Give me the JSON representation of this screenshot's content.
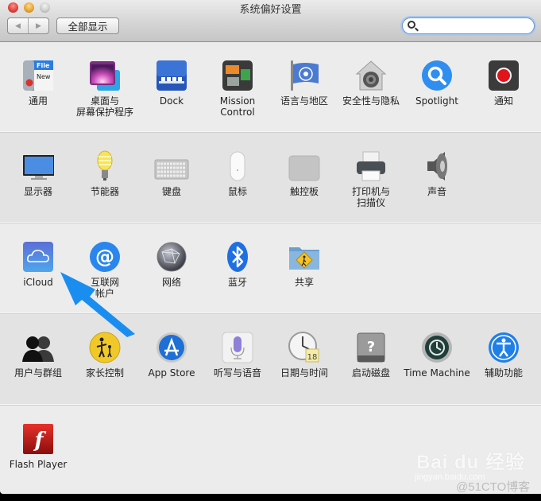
{
  "window": {
    "title": "系统偏好设置",
    "show_all_label": "全部显示",
    "back_icon": "◀",
    "forward_icon": "▶",
    "search": {
      "value": "",
      "placeholder": ""
    }
  },
  "sections": [
    {
      "items": [
        {
          "id": "general",
          "label": "通用",
          "icon": "general-icon"
        },
        {
          "id": "desktop",
          "label": "桌面与\n屏幕保护程序",
          "icon": "desktop-screensaver-icon"
        },
        {
          "id": "dock",
          "label": "Dock",
          "icon": "dock-icon"
        },
        {
          "id": "mission-control",
          "label": "Mission\nControl",
          "icon": "mission-control-icon"
        },
        {
          "id": "language",
          "label": "语言与地区",
          "icon": "language-flag-icon"
        },
        {
          "id": "security",
          "label": "安全性与隐私",
          "icon": "security-lock-icon"
        },
        {
          "id": "spotlight",
          "label": "Spotlight",
          "icon": "spotlight-icon"
        },
        {
          "id": "notifications",
          "label": "通知",
          "icon": "notifications-icon"
        }
      ]
    },
    {
      "items": [
        {
          "id": "displays",
          "label": "显示器",
          "icon": "display-icon"
        },
        {
          "id": "energy",
          "label": "节能器",
          "icon": "lightbulb-icon"
        },
        {
          "id": "keyboard",
          "label": "键盘",
          "icon": "keyboard-icon"
        },
        {
          "id": "mouse",
          "label": "鼠标",
          "icon": "mouse-icon"
        },
        {
          "id": "trackpad",
          "label": "触控板",
          "icon": "trackpad-icon"
        },
        {
          "id": "printers",
          "label": "打印机与\n扫描仪",
          "icon": "printer-icon"
        },
        {
          "id": "sound",
          "label": "声音",
          "icon": "speaker-icon"
        }
      ]
    },
    {
      "items": [
        {
          "id": "icloud",
          "label": "iCloud",
          "icon": "icloud-icon"
        },
        {
          "id": "internet-accounts",
          "label": "互联网\n帐户",
          "icon": "at-sign-icon"
        },
        {
          "id": "network",
          "label": "网络",
          "icon": "network-globe-icon"
        },
        {
          "id": "bluetooth",
          "label": "蓝牙",
          "icon": "bluetooth-icon"
        },
        {
          "id": "sharing",
          "label": "共享",
          "icon": "sharing-folder-icon"
        }
      ]
    },
    {
      "items": [
        {
          "id": "users",
          "label": "用户与群组",
          "icon": "users-icon"
        },
        {
          "id": "parental",
          "label": "家长控制",
          "icon": "parental-controls-icon"
        },
        {
          "id": "appstore",
          "label": "App Store",
          "icon": "app-store-icon"
        },
        {
          "id": "dictation",
          "label": "听写与语音",
          "icon": "microphone-icon"
        },
        {
          "id": "datetime",
          "label": "日期与时间",
          "icon": "clock-calendar-icon",
          "badge": "18"
        },
        {
          "id": "startup",
          "label": "启动磁盘",
          "icon": "startup-disk-icon"
        },
        {
          "id": "timemachine",
          "label": "Time Machine",
          "icon": "time-machine-icon"
        },
        {
          "id": "accessibility",
          "label": "辅助功能",
          "icon": "accessibility-icon"
        }
      ]
    },
    {
      "items": [
        {
          "id": "flash",
          "label": "Flash Player",
          "icon": "flash-player-icon"
        }
      ]
    }
  ],
  "icon_text": {
    "general_file": "File",
    "general_new": "New",
    "calendar_day": "18",
    "startup_q": "?",
    "flash_f": "f",
    "at": "@"
  },
  "annotation": {
    "type": "arrow",
    "color": "#1a8ef0",
    "points_to": "iCloud"
  },
  "watermark": {
    "brand": "Bai du 经验",
    "url": "jingyan.baidu.com",
    "source": "@51CTO博客"
  },
  "colors": {
    "accent": "#1a8ef0",
    "search_focus": "#a9c8ef"
  }
}
